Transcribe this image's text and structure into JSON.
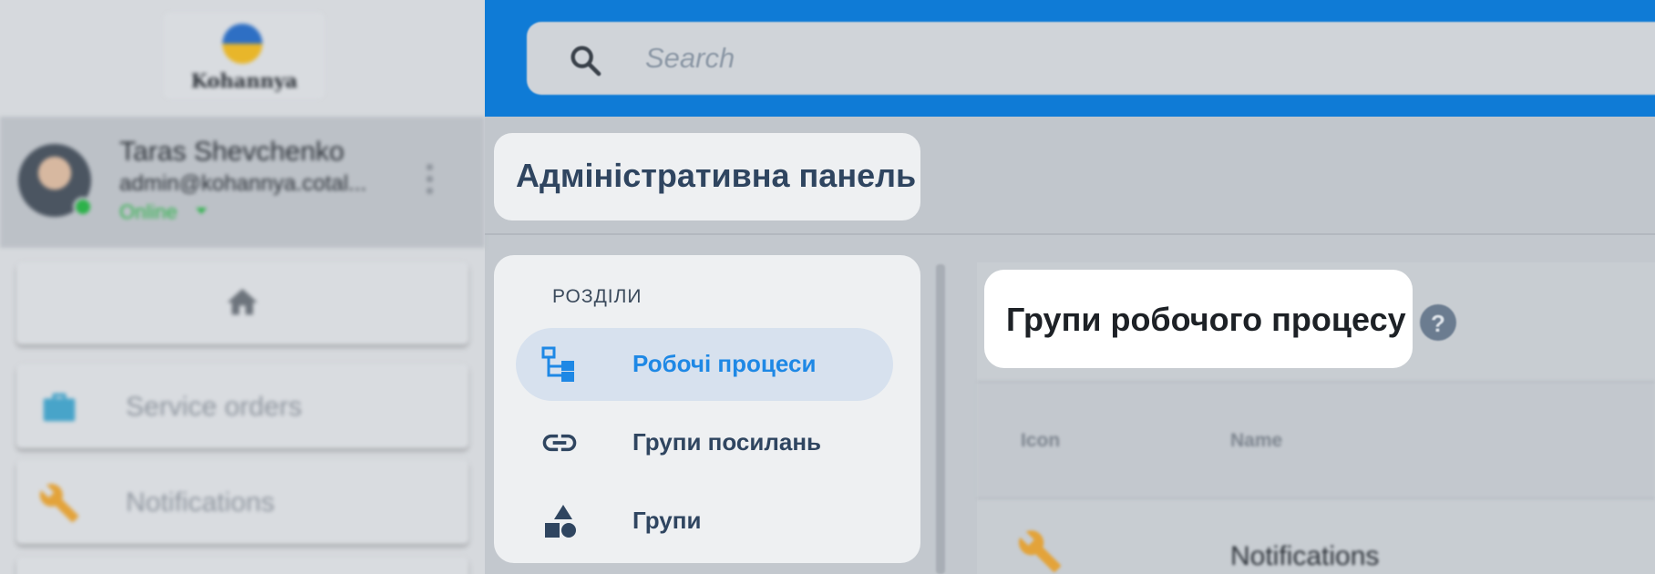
{
  "app": {
    "logo_text": "Kohannya"
  },
  "user": {
    "name": "Taras Shevchenko",
    "email": "admin@kohannya.cotal...",
    "status": "Online",
    "status_color": "#2db24a"
  },
  "sidebar": {
    "items": [
      {
        "icon": "home-icon",
        "label": ""
      },
      {
        "icon": "briefcase-icon",
        "label": "Service orders",
        "icon_color": "#48a4c9"
      },
      {
        "icon": "wrench-icon",
        "label": "Notifications",
        "icon_color": "#e3a33a"
      }
    ]
  },
  "search": {
    "placeholder": "Search"
  },
  "header": {
    "title": "Адміністративна панель",
    "topbar_color": "#0f7bd6"
  },
  "sections": {
    "heading": "РОЗДІЛИ",
    "items": [
      {
        "icon": "workflow-tree-icon",
        "label": "Робочі процеси",
        "active": true
      },
      {
        "icon": "link-icon",
        "label": "Групи посилань",
        "active": false
      },
      {
        "icon": "shapes-icon",
        "label": "Групи",
        "active": false
      }
    ],
    "accent_color": "#1e88e5"
  },
  "main": {
    "section_title": "Групи робочого процесу",
    "help_icon": "help-icon",
    "table": {
      "columns": [
        "Icon",
        "Name"
      ],
      "rows": [
        {
          "icon": "wrench-icon",
          "name": "Notifications"
        }
      ]
    }
  }
}
